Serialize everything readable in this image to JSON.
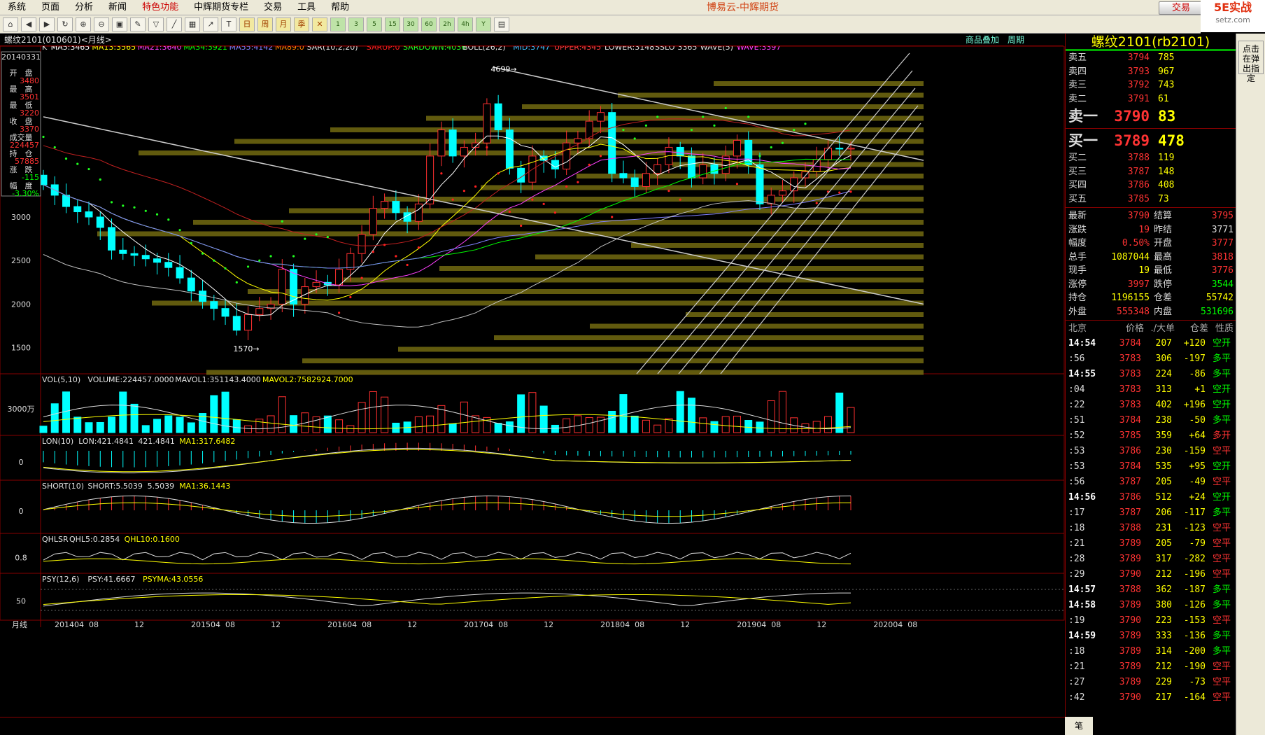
{
  "menu": [
    "系统",
    "页面",
    "分析",
    "新闻",
    "特色功能",
    "中辉期货专栏",
    "交易",
    "工具",
    "帮助"
  ],
  "menu_special": 4,
  "app_title": "博易云-中辉期货",
  "trade_button": "交易",
  "logo": {
    "brand": "5E实战",
    "site": "setz.com"
  },
  "chart_header": {
    "symbol": "螺纹2101(010601)<月线>",
    "links": [
      "商品叠加",
      "周期"
    ]
  },
  "side_note": "点击在弹出指定",
  "main_legend": [
    {
      "t": "K",
      "c": "#e0e0e0"
    },
    {
      "t": "MA5:3465",
      "c": "#ffffff"
    },
    {
      "t": "MA13:3565",
      "c": "#ffff00"
    },
    {
      "t": "MA21:3640",
      "c": "#ff40ff"
    },
    {
      "t": "MA34:3921",
      "c": "#00ff00"
    },
    {
      "t": "MA55:4142",
      "c": "#8080ff"
    },
    {
      "t": "MA89:0",
      "c": "#ff8000"
    },
    {
      "t": "SAR(10,2,20)",
      "c": "#e0e0e0"
    },
    {
      "t": "SARUP:0",
      "c": "#ff2020"
    },
    {
      "t": "SARDOWN:4036",
      "c": "#20ff20"
    },
    {
      "t": "BOLL(26,2)",
      "c": "#e0e0e0"
    },
    {
      "t": "MID:3747",
      "c": "#40c0ff"
    },
    {
      "t": "UPPER:4345",
      "c": "#ff4040"
    },
    {
      "t": "LOWER:3148",
      "c": "#e0e0e0"
    },
    {
      "t": "SSLO",
      "c": "#e0e0e0"
    },
    {
      "t": "3365",
      "c": "#e0e0e0"
    },
    {
      "t": "WAVE(5)",
      "c": "#e0e0e0"
    },
    {
      "t": "WAVE:3397",
      "c": "#ff40ff"
    }
  ],
  "info_box": [
    {
      "label": "20140331",
      "value": ""
    },
    {
      "label": "开　盘",
      "value": "3480"
    },
    {
      "label": "最　高",
      "value": "3501"
    },
    {
      "label": "最　低",
      "value": "3220"
    },
    {
      "label": "收　盘",
      "value": "3370"
    },
    {
      "label": "成交量",
      "value": "224457"
    },
    {
      "label": "持　仓",
      "value": "57885"
    },
    {
      "label": "涨　跌",
      "value": "-115"
    },
    {
      "label": "幅　度",
      "value": "-3.30%"
    }
  ],
  "price_axis": [
    "3000",
    "2500",
    "2000",
    "1500"
  ],
  "marks": {
    "high": "4699",
    "low": "1570"
  },
  "panels": {
    "vol": {
      "legend": [
        {
          "t": "VOL(5,10)",
          "c": "#e0e0e0"
        },
        {
          "t": "VOLUME:224457.0000",
          "c": "#e0e0e0"
        },
        {
          "t": "MAVOL1:351143.4000",
          "c": "#e0e0e0"
        },
        {
          "t": "MAVOL2:7582924.7000",
          "c": "#ffff00"
        }
      ],
      "axis": "3000万"
    },
    "lon": {
      "legend": [
        {
          "t": "LON(10)",
          "c": "#e0e0e0"
        },
        {
          "t": "LON:421.4841",
          "c": "#e0e0e0"
        },
        {
          "t": "421.4841",
          "c": "#e0e0e0"
        },
        {
          "t": "MA1:317.6482",
          "c": "#ffff00"
        }
      ],
      "axis": "0"
    },
    "short": {
      "legend": [
        {
          "t": "SHORT(10)",
          "c": "#e0e0e0"
        },
        {
          "t": "SHORT:5.5039",
          "c": "#e0e0e0"
        },
        {
          "t": "5.5039",
          "c": "#e0e0e0"
        },
        {
          "t": "MA1:36.1443",
          "c": "#ffff00"
        }
      ],
      "axis": "0"
    },
    "qhlsr": {
      "legend": [
        {
          "t": "QHLSR",
          "c": "#e0e0e0"
        },
        {
          "t": "QHL5:0.2854",
          "c": "#e0e0e0"
        },
        {
          "t": "QHL10:0.1600",
          "c": "#ffff00"
        }
      ],
      "axis": "0.8"
    },
    "psy": {
      "legend": [
        {
          "t": "PSY(12,6)",
          "c": "#e0e0e0"
        },
        {
          "t": "PSY:41.6667",
          "c": "#e0e0e0"
        },
        {
          "t": "PSYMA:43.0556",
          "c": "#ffff00"
        }
      ],
      "axis": "50"
    }
  },
  "x_axis": {
    "label": "月线",
    "ticks": [
      "201404",
      "08",
      "12",
      "201504",
      "08",
      "12",
      "201604",
      "08",
      "12",
      "201704",
      "08",
      "12",
      "201804",
      "08",
      "12",
      "201904",
      "08",
      "12",
      "202004",
      "08"
    ]
  },
  "quote": {
    "title": "螺纹2101(rb2101)",
    "asks": [
      {
        "l": "卖五",
        "p": "3794",
        "v": "785"
      },
      {
        "l": "卖四",
        "p": "3793",
        "v": "967"
      },
      {
        "l": "卖三",
        "p": "3792",
        "v": "743"
      },
      {
        "l": "卖二",
        "p": "3791",
        "v": "61"
      },
      {
        "l": "卖一",
        "p": "3790",
        "v": "83",
        "big": true
      }
    ],
    "bids": [
      {
        "l": "买一",
        "p": "3789",
        "v": "478",
        "big": true
      },
      {
        "l": "买二",
        "p": "3788",
        "v": "119"
      },
      {
        "l": "买三",
        "p": "3787",
        "v": "148"
      },
      {
        "l": "买四",
        "p": "3786",
        "v": "408"
      },
      {
        "l": "买五",
        "p": "3785",
        "v": "73"
      }
    ],
    "stats": [
      {
        "a": "最新",
        "b": "3790",
        "bc": "#f33",
        "c": "结算",
        "d": "3795",
        "dc": "#f33"
      },
      {
        "a": "涨跌",
        "b": "19",
        "bc": "#f33",
        "c": "昨结",
        "d": "3771",
        "dc": "#ddd"
      },
      {
        "a": "幅度",
        "b": "0.50%",
        "bc": "#f33",
        "c": "开盘",
        "d": "3777",
        "dc": "#f33"
      },
      {
        "a": "总手",
        "b": "1087044",
        "bc": "#ff0",
        "c": "最高",
        "d": "3818",
        "dc": "#f33"
      },
      {
        "a": "现手",
        "b": "19",
        "bc": "#ff0",
        "c": "最低",
        "d": "3776",
        "dc": "#f33"
      },
      {
        "a": "涨停",
        "b": "3997",
        "bc": "#f33",
        "c": "跌停",
        "d": "3544",
        "dc": "#0f0"
      },
      {
        "a": "持仓",
        "b": "1196155",
        "bc": "#ff0",
        "c": "仓差",
        "d": "55742",
        "dc": "#ff0"
      },
      {
        "a": "外盘",
        "b": "555348",
        "bc": "#f33",
        "c": "内盘",
        "d": "531696",
        "dc": "#0f0"
      }
    ],
    "tick_header": [
      "北京",
      "价格",
      "./大单",
      "仓差",
      "性质"
    ],
    "ticks": [
      {
        "t": "14:54",
        "b": true,
        "p": "3784",
        "v": "207",
        "o": "+120",
        "x": "空开",
        "oc": "#ff0",
        "xc": "#0f0"
      },
      {
        "t": ":56",
        "p": "3783",
        "v": "306",
        "o": "-197",
        "x": "多平",
        "oc": "#ff0",
        "xc": "#0f0"
      },
      {
        "t": "14:55",
        "b": true,
        "p": "3783",
        "v": "224",
        "o": "-86",
        "x": "多平",
        "oc": "#ff0",
        "xc": "#0f0"
      },
      {
        "t": ":04",
        "p": "3783",
        "v": "313",
        "o": "+1",
        "x": "空开",
        "oc": "#ff0",
        "xc": "#0f0"
      },
      {
        "t": ":22",
        "p": "3783",
        "v": "402",
        "o": "+196",
        "x": "空开",
        "oc": "#ff0",
        "xc": "#0f0"
      },
      {
        "t": ":51",
        "p": "3784",
        "v": "238",
        "o": "-50",
        "x": "多平",
        "oc": "#ff0",
        "xc": "#0f0"
      },
      {
        "t": ":52",
        "p": "3785",
        "v": "359",
        "o": "+64",
        "x": "多开",
        "oc": "#ff0",
        "xc": "#f33"
      },
      {
        "t": ":53",
        "p": "3786",
        "v": "230",
        "o": "-159",
        "x": "空平",
        "oc": "#ff0",
        "xc": "#f33"
      },
      {
        "t": ":53",
        "p": "3784",
        "v": "535",
        "o": "+95",
        "x": "空开",
        "oc": "#ff0",
        "xc": "#0f0"
      },
      {
        "t": ":56",
        "p": "3787",
        "v": "205",
        "o": "-49",
        "x": "空平",
        "oc": "#ff0",
        "xc": "#f33"
      },
      {
        "t": "14:56",
        "b": true,
        "p": "3786",
        "v": "512",
        "o": "+24",
        "x": "空开",
        "oc": "#ff0",
        "xc": "#0f0"
      },
      {
        "t": ":17",
        "p": "3787",
        "v": "206",
        "o": "-117",
        "x": "多平",
        "oc": "#ff0",
        "xc": "#0f0"
      },
      {
        "t": ":18",
        "p": "3788",
        "v": "231",
        "o": "-123",
        "x": "空平",
        "oc": "#ff0",
        "xc": "#f33"
      },
      {
        "t": ":21",
        "p": "3789",
        "v": "205",
        "o": "-79",
        "x": "空平",
        "oc": "#ff0",
        "xc": "#f33"
      },
      {
        "t": ":28",
        "p": "3789",
        "v": "317",
        "o": "-282",
        "x": "空平",
        "oc": "#ff0",
        "xc": "#f33"
      },
      {
        "t": ":29",
        "p": "3790",
        "v": "212",
        "o": "-196",
        "x": "空平",
        "oc": "#ff0",
        "xc": "#f33"
      },
      {
        "t": "14:57",
        "b": true,
        "p": "3788",
        "v": "362",
        "o": "-187",
        "x": "多平",
        "oc": "#ff0",
        "xc": "#0f0"
      },
      {
        "t": "14:58",
        "b": true,
        "p": "3789",
        "v": "380",
        "o": "-126",
        "x": "多平",
        "oc": "#ff0",
        "xc": "#0f0"
      },
      {
        "t": ":19",
        "p": "3790",
        "v": "223",
        "o": "-153",
        "x": "空平",
        "oc": "#ff0",
        "xc": "#f33"
      },
      {
        "t": "14:59",
        "b": true,
        "p": "3789",
        "v": "333",
        "o": "-136",
        "x": "多平",
        "oc": "#ff0",
        "xc": "#0f0"
      },
      {
        "t": ":18",
        "p": "3789",
        "v": "314",
        "o": "-200",
        "x": "多平",
        "oc": "#ff0",
        "xc": "#0f0"
      },
      {
        "t": ":21",
        "p": "3789",
        "v": "212",
        "o": "-190",
        "x": "空平",
        "oc": "#ff0",
        "xc": "#f33"
      },
      {
        "t": ":27",
        "p": "3789",
        "v": "229",
        "o": "-73",
        "x": "空平",
        "oc": "#ff0",
        "xc": "#f33"
      },
      {
        "t": ":42",
        "p": "3790",
        "v": "217",
        "o": "-164",
        "x": "空平",
        "oc": "#ff0",
        "xc": "#f33"
      }
    ]
  },
  "bottom_tab": "笔",
  "chart_data": {
    "type": "candlestick",
    "title": "螺纹2101(010601)<月线>",
    "period": "monthly",
    "ylim": [
      1200,
      4800
    ],
    "months": 78,
    "start": "201404",
    "closes": [
      3370,
      3250,
      3120,
      3060,
      3000,
      2880,
      2620,
      2580,
      2560,
      2520,
      2480,
      2420,
      2300,
      2150,
      2030,
      1950,
      1860,
      1700,
      1880,
      1950,
      2000,
      2400,
      2000,
      2200,
      2250,
      2220,
      2400,
      2580,
      2800,
      3100,
      3180,
      3050,
      2950,
      3150,
      3700,
      4000,
      3700,
      3800,
      3850,
      4300,
      4000,
      3560,
      3400,
      3700,
      3650,
      3550,
      3850,
      3900,
      4100,
      4200,
      3500,
      3450,
      3350,
      3500,
      3600,
      3800,
      3700,
      3450,
      3600,
      3500,
      3700,
      3880,
      3600,
      3150,
      3250,
      3300,
      3450,
      3520,
      3660,
      3790,
      3780,
      3790
    ]
  }
}
